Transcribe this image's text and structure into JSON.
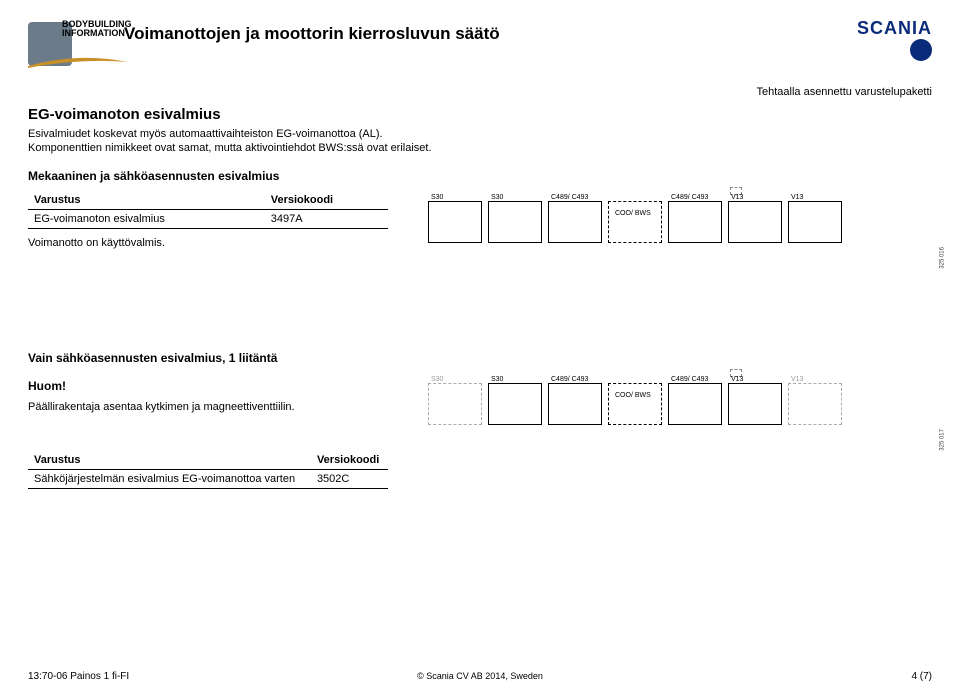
{
  "header": {
    "badge_line1": "BODYBUILDING",
    "badge_line2": "INFORMATION",
    "title": "Voimanottojen ja moottorin kierrosluvun säätö",
    "brand": "SCANIA",
    "package_note": "Tehtaalla asennettu varustelupaketti"
  },
  "section1": {
    "heading": "EG-voimanoton esivalmius",
    "paragraph": "Esivalmiudet koskevat myös automaattivaihteiston EG-voimanottoa (AL). Komponenttien nimikkeet ovat samat, mutta aktivointiehdot BWS:ssä ovat erilaiset.",
    "subheading": "Mekaaninen ja sähköasennusten esivalmius",
    "table": {
      "head_equip": "Varustus",
      "head_code": "Versiokoodi",
      "row_equip": "EG-voimanoton esivalmius",
      "row_code": "3497A"
    },
    "note": "Voimanotto on käyttövalmis.",
    "diagram": {
      "b1": "S30",
      "b2": "S30",
      "b3": "C489/\nC493",
      "b4": "COO/\nBWS",
      "b5": "C489/\nC493",
      "b6": "V13",
      "b7": "V13",
      "figno": "325 016"
    }
  },
  "section2": {
    "heading": "Vain sähköasennusten esivalmius, 1 liitäntä",
    "huom": "Huom!",
    "paragraph": "Päällirakentaja asentaa kytkimen ja magneettiventtiilin.",
    "table": {
      "head_equip": "Varustus",
      "head_code": "Versiokoodi",
      "row_equip": "Sähköjärjestelmän esivalmius EG-voimanottoa varten",
      "row_code": "3502C"
    },
    "diagram": {
      "b1": "S30",
      "b2": "S30",
      "b3": "C489/\nC493",
      "b4": "COO/\nBWS",
      "b5": "C489/\nC493",
      "b6": "V13",
      "b7": "V13",
      "figno": "325 017"
    }
  },
  "footer": {
    "left": "13:70-06 Painos 1 fi-FI",
    "center": "© Scania CV AB 2014, Sweden",
    "right": "4 (7)"
  }
}
